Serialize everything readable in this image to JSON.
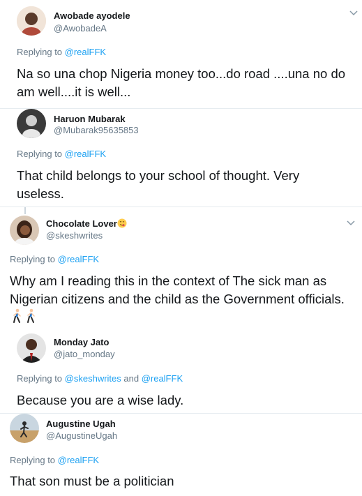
{
  "tweets": [
    {
      "name": "Awobade ayodele",
      "handle": "@AwobadeA",
      "replying_prefix": "Replying to ",
      "replying_to": "@realFFK",
      "body": "Na so una chop Nigeria money too...do road ....una no do am well....it is well..."
    },
    {
      "name": "Haruon Mubarak",
      "handle": "@Mubarak95635853",
      "replying_prefix": "Replying to ",
      "replying_to": "@realFFK",
      "body": "That child belongs to your school of thought. Very useless."
    },
    {
      "name": "Chocolate Lover",
      "handle": "@skeshwrites",
      "replying_prefix": "Replying to ",
      "replying_to": "@realFFK",
      "body": "Why am I reading this in the context of The sick man as Nigerian citizens and the child as the Government officials."
    },
    {
      "name": "Monday Jato",
      "handle": "@jato_monday",
      "replying_prefix": "Replying to ",
      "replying_to": "@skeshwrites",
      "replying_and": " and ",
      "replying_to_2": "@realFFK",
      "body": "Because you are a wise lady."
    },
    {
      "name": "Augustine Ugah",
      "handle": "@AugustineUgah",
      "replying_prefix": "Replying to ",
      "replying_to": "@realFFK",
      "body": "That son must be a politician"
    }
  ],
  "icons": {
    "more": "chevron-down-icon",
    "name_emoji": "face-savoring-emoji",
    "body_emoji": "person-walking-emoji"
  },
  "colors": {
    "link": "#1da1f2",
    "muted": "#657786",
    "text": "#14171a"
  }
}
